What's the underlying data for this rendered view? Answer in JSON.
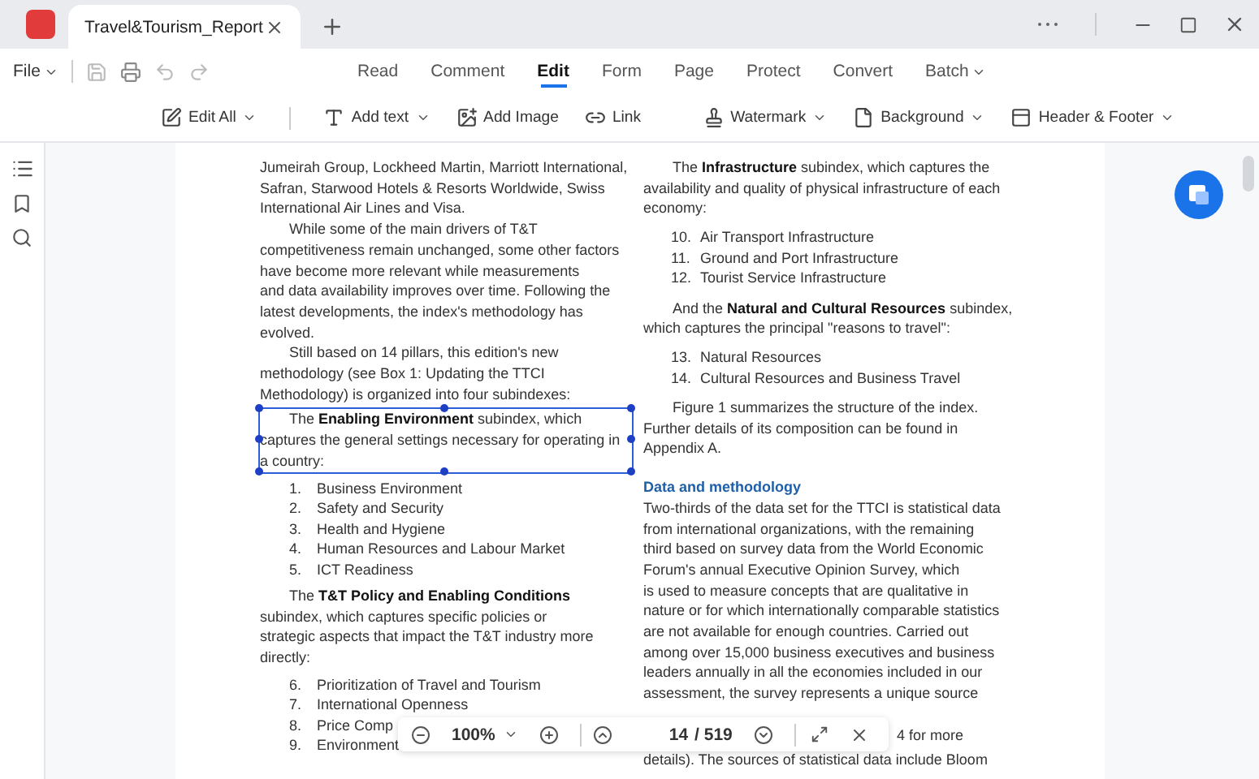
{
  "tab": {
    "title": "Travel&Tourism_Report"
  },
  "menu": {
    "file": "File",
    "tabs": [
      {
        "label": "Read",
        "selected": false
      },
      {
        "label": "Comment",
        "selected": false
      },
      {
        "label": "Edit",
        "selected": true
      },
      {
        "label": "Form",
        "selected": false
      },
      {
        "label": "Page",
        "selected": false
      },
      {
        "label": "Protect",
        "selected": false
      },
      {
        "label": "Convert",
        "selected": false
      },
      {
        "label": "Batch",
        "selected": false,
        "dropdown": true
      }
    ]
  },
  "tools": [
    {
      "label": "Edit All",
      "dropdown": true
    },
    {
      "label": "Add text",
      "dropdown": true
    },
    {
      "label": "Add Image",
      "dropdown": false
    },
    {
      "label": "Link",
      "dropdown": false
    },
    {
      "label": "Watermark",
      "dropdown": true
    },
    {
      "label": "Background",
      "dropdown": true
    },
    {
      "label": "Header & Footer",
      "dropdown": true
    }
  ],
  "document": {
    "left": [
      {
        "kind": "continued",
        "selected": false,
        "text": "Jumeirah Group, Lockheed Martin, Marriott International,\nSafran, Starwood Hotels & Resorts Worldwide, Swiss\nInternational Air Lines and Visa."
      },
      {
        "kind": "para",
        "selected": false,
        "text": "While some of the main drivers of T&T\ncompetitiveness remain unchanged, some other factors\nhave become more relevant while measurements\nand data availability improves over time. Following the\nlatest developments, the index's methodology has\nevolved."
      },
      {
        "kind": "para",
        "selected": false,
        "text": "Still based on 14 pillars, this edition's new\nmethodology (see Box 1: Updating the TTCI\nMethodology) is organized into four subindexes:"
      },
      {
        "kind": "para",
        "selected": true,
        "text": "The **Enabling Environment** subindex, which\ncaptures the general settings necessary for operating in\na country:"
      },
      {
        "kind": "list",
        "items": [
          {
            "num": "1.",
            "text": "Business Environment"
          },
          {
            "num": "2.",
            "text": "Safety and Security"
          },
          {
            "num": "3.",
            "text": "Health and Hygiene"
          },
          {
            "num": "4.",
            "text": "Human Resources and Labour Market"
          },
          {
            "num": "5.",
            "text": "ICT Readiness"
          }
        ]
      },
      {
        "kind": "para",
        "selected": false,
        "text": "The **T&T Policy and Enabling Conditions**\nsubindex, which captures specific policies or\nstrategic aspects that impact the T&T industry more\ndirectly:"
      },
      {
        "kind": "list",
        "items": [
          {
            "num": "6.",
            "text": "Prioritization of Travel and Tourism"
          },
          {
            "num": "7.",
            "text": "International Openness"
          },
          {
            "num": "8.",
            "text": "Price Comp"
          },
          {
            "num": "9.",
            "text": "Environment"
          }
        ]
      }
    ],
    "right": [
      {
        "kind": "para",
        "selected": false,
        "text": "The **Infrastructure** subindex, which captures the\navailability and quality of physical infrastructure of each\neconomy:"
      },
      {
        "kind": "list",
        "items": [
          {
            "num": "10.",
            "text": "Air Transport Infrastructure"
          },
          {
            "num": "11.",
            "text": "Ground and Port Infrastructure"
          },
          {
            "num": "12.",
            "text": "Tourist Service Infrastructure"
          }
        ]
      },
      {
        "kind": "para",
        "selected": false,
        "text": "And the **Natural and Cultural Resources** subindex,\nwhich captures the principal \"reasons to travel\":"
      },
      {
        "kind": "list",
        "items": [
          {
            "num": "13.",
            "text": "Natural Resources"
          },
          {
            "num": "14.",
            "text": "Cultural Resources and Business Travel"
          }
        ]
      },
      {
        "kind": "para",
        "selected": false,
        "text": "Figure 1 summarizes the structure of the index.\nFurther details of its composition can be found in\nAppendix A."
      },
      {
        "kind": "heading",
        "text": "Data and methodology"
      },
      {
        "kind": "continued",
        "selected": false,
        "text": "Two-thirds of the data set for the TTCI is statistical data\nfrom international organizations, with the remaining\nthird based on survey data from the World Economic\nForum's annual Executive Opinion Survey, which\nis used to measure concepts that are qualitative in\nnature or for which internationally comparable statistics\nare not available for enough countries. Carried out\namong over 15,000 business executives and business\nleaders annually in all the economies included in our\nassessment, the survey represents a unique source"
      },
      {
        "kind": "partial",
        "text": "4 for more"
      },
      {
        "kind": "continued",
        "selected": false,
        "text": "details). The sources of statistical data include Bloom"
      }
    ]
  },
  "zoom_bar": {
    "zoom": "100%",
    "page": "14",
    "total": "/ 519"
  }
}
